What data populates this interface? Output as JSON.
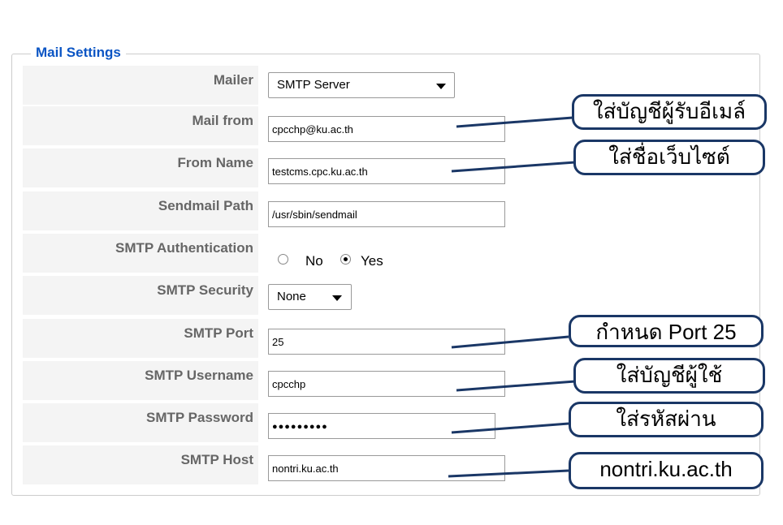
{
  "legend": "Mail Settings",
  "rows": {
    "mailer": {
      "label": "Mailer",
      "value": "SMTP Server"
    },
    "mail_from": {
      "label": "Mail from",
      "value": "cpcchp@ku.ac.th"
    },
    "from_name": {
      "label": "From Name",
      "value": "testcms.cpc.ku.ac.th"
    },
    "sendmail_path": {
      "label": "Sendmail Path",
      "value": "/usr/sbin/sendmail"
    },
    "smtp_auth": {
      "label": "SMTP Authentication",
      "options": [
        "No",
        "Yes"
      ],
      "selected": "Yes"
    },
    "smtp_security": {
      "label": "SMTP Security",
      "value": "None"
    },
    "smtp_port": {
      "label": "SMTP Port",
      "value": "25"
    },
    "smtp_username": {
      "label": "SMTP Username",
      "value": "cpcchp"
    },
    "smtp_password": {
      "label": "SMTP Password",
      "value": "●●●●●●●●●"
    },
    "smtp_host": {
      "label": "SMTP Host",
      "value": "nontri.ku.ac.th"
    }
  },
  "callouts": {
    "mail_from": "ใส่บัญชีผู้รับอีเมล์",
    "from_name": "ใส่ชื่อเว็บไซต์",
    "smtp_port": "กำหนด Port 25",
    "smtp_username": "ใส่บัญชีผู้ใช้",
    "smtp_password": "ใส่รหัสผ่าน",
    "smtp_host": "nontri.ku.ac.th"
  },
  "colors": {
    "legend": "#0b55c4",
    "label_bg": "#f4f4f4",
    "label_text": "#666666",
    "callout_border": "#1a3766"
  }
}
